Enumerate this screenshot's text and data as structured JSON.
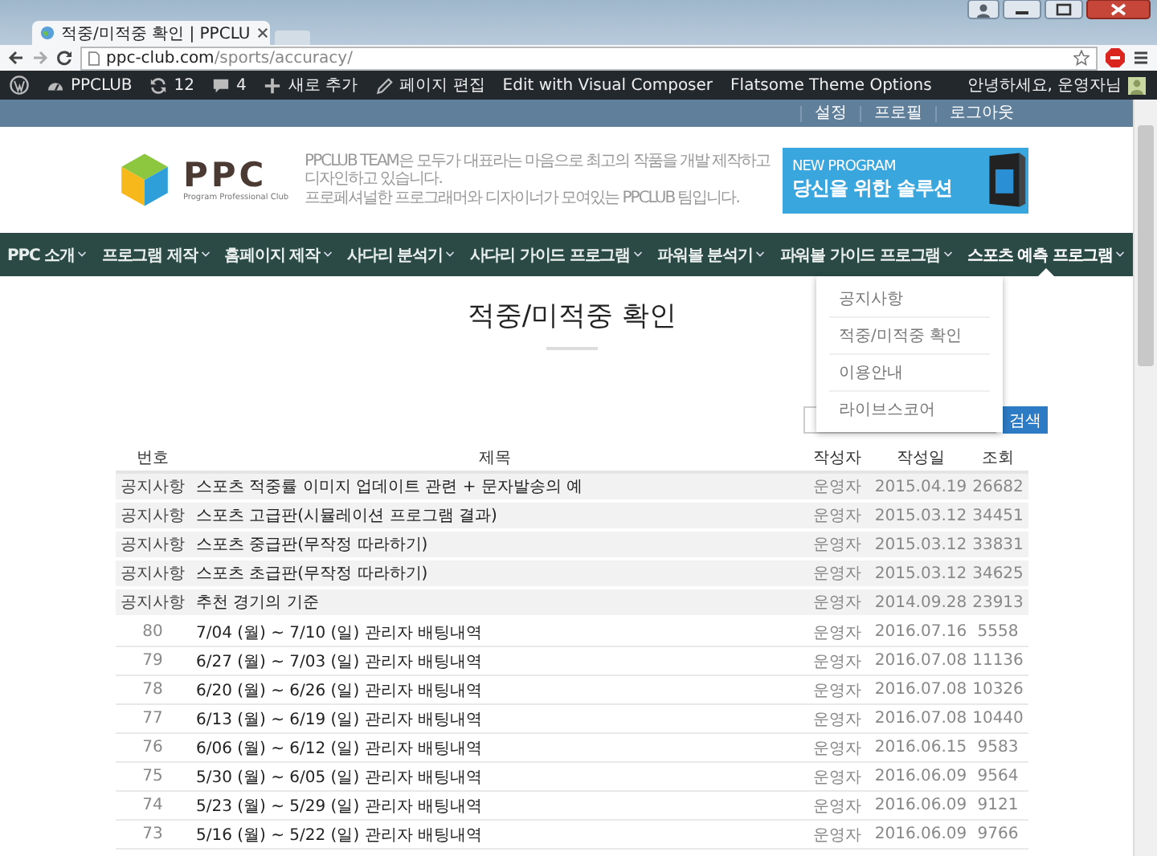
{
  "browser": {
    "tab_title": "적중/미적중 확인 | PPCLU",
    "url": "ppc-club.com/sports/accuracy/"
  },
  "admin_bar": {
    "items": [
      {
        "kind": "wp"
      },
      {
        "kind": "site",
        "label": "PPCLUB"
      },
      {
        "kind": "updates",
        "label": "12"
      },
      {
        "kind": "comments",
        "label": "4"
      },
      {
        "kind": "new",
        "label": "새로 추가"
      },
      {
        "kind": "edit",
        "label": "페이지 편집"
      },
      {
        "kind": "text",
        "label": "Edit with Visual Composer"
      },
      {
        "kind": "text",
        "label": "Flatsome Theme Options"
      }
    ],
    "greeting": "안녕하세요, 운영자님"
  },
  "top_links": [
    "설정",
    "프로필",
    "로그아웃"
  ],
  "header": {
    "logo_text": "PPC",
    "logo_sub": "Program Professional Club",
    "tagline": [
      "PPCLUB TEAM은 모두가 대표라는 마음으로 최고의 작품을 개발 제작하고 디자인하고 있습니다.",
      "프로페셔널한 프로그래머와 디자이너가 모여있는 PPCLUB 팀입니다."
    ],
    "banner": {
      "kicker": "NEW PROGRAM",
      "headline": "당신을 위한 솔루션"
    }
  },
  "nav": [
    {
      "label": "PPC 소개",
      "selected": false
    },
    {
      "label": "프로그램 제작",
      "selected": false
    },
    {
      "label": "홈페이지 제작",
      "selected": false
    },
    {
      "label": "사다리 분석기",
      "selected": false
    },
    {
      "label": "사다리 가이드 프로그램",
      "selected": false
    },
    {
      "label": "파워볼 분석기",
      "selected": false
    },
    {
      "label": "파워볼 가이드 프로그램",
      "selected": false
    },
    {
      "label": "스포츠 예측 프로그램",
      "selected": true
    }
  ],
  "dropdown": [
    "공지사항",
    "적중/미적중 확인",
    "이용안내",
    "라이브스코어"
  ],
  "page_title": "적중/미적중 확인",
  "search": {
    "button": "검색"
  },
  "table": {
    "columns": [
      "번호",
      "제목",
      "작성자",
      "작성일",
      "조회"
    ],
    "rows": [
      {
        "kind": "notice",
        "cells": [
          "공지사항",
          "스포츠 적중률 이미지 업데이트 관련 + 문자발송의 예",
          "운영자",
          "2015.04.19",
          "26682"
        ]
      },
      {
        "kind": "notice",
        "cells": [
          "공지사항",
          "스포츠 고급판(시뮬레이션 프로그램 결과)",
          "운영자",
          "2015.03.12",
          "34451"
        ]
      },
      {
        "kind": "notice",
        "cells": [
          "공지사항",
          "스포츠 중급판(무작정 따라하기)",
          "운영자",
          "2015.03.12",
          "33831"
        ]
      },
      {
        "kind": "notice",
        "cells": [
          "공지사항",
          "스포츠 초급판(무작정 따라하기)",
          "운영자",
          "2015.03.12",
          "34625"
        ]
      },
      {
        "kind": "notice",
        "cells": [
          "공지사항",
          "추천 경기의 기준",
          "운영자",
          "2014.09.28",
          "23913"
        ]
      },
      {
        "kind": "post",
        "cells": [
          "80",
          "7/04 (월) ~ 7/10 (일) 관리자 배팅내역",
          "운영자",
          "2016.07.16",
          "5558"
        ]
      },
      {
        "kind": "post",
        "cells": [
          "79",
          "6/27 (월) ~ 7/03 (일) 관리자 배팅내역",
          "운영자",
          "2016.07.08",
          "11136"
        ]
      },
      {
        "kind": "post",
        "cells": [
          "78",
          "6/20 (월) ~ 6/26 (일) 관리자 배팅내역",
          "운영자",
          "2016.07.08",
          "10326"
        ]
      },
      {
        "kind": "post",
        "cells": [
          "77",
          "6/13 (월) ~ 6/19 (일) 관리자 배팅내역",
          "운영자",
          "2016.07.08",
          "10440"
        ]
      },
      {
        "kind": "post",
        "cells": [
          "76",
          "6/06 (월) ~ 6/12 (일) 관리자 배팅내역",
          "운영자",
          "2016.06.15",
          "9583"
        ]
      },
      {
        "kind": "post",
        "cells": [
          "75",
          "5/30 (월) ~ 6/05 (일) 관리자 배팅내역",
          "운영자",
          "2016.06.09",
          "9564"
        ]
      },
      {
        "kind": "post",
        "cells": [
          "74",
          "5/23 (월) ~ 5/29 (일) 관리자 배팅내역",
          "운영자",
          "2016.06.09",
          "9121"
        ]
      },
      {
        "kind": "post",
        "cells": [
          "73",
          "5/16 (월) ~ 5/22 (일) 관리자 배팅내역",
          "운영자",
          "2016.06.09",
          "9766"
        ]
      }
    ]
  }
}
